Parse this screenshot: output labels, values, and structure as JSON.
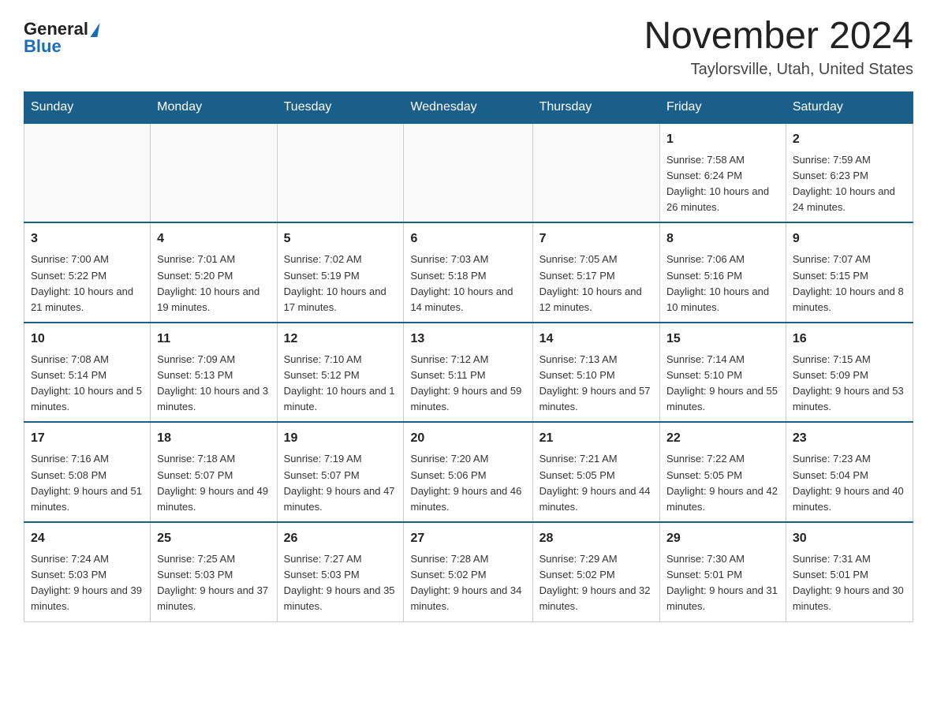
{
  "logo": {
    "general": "General",
    "blue": "Blue"
  },
  "title": "November 2024",
  "location": "Taylorsville, Utah, United States",
  "days_of_week": [
    "Sunday",
    "Monday",
    "Tuesday",
    "Wednesday",
    "Thursday",
    "Friday",
    "Saturday"
  ],
  "weeks": [
    [
      {
        "day": "",
        "info": ""
      },
      {
        "day": "",
        "info": ""
      },
      {
        "day": "",
        "info": ""
      },
      {
        "day": "",
        "info": ""
      },
      {
        "day": "",
        "info": ""
      },
      {
        "day": "1",
        "info": "Sunrise: 7:58 AM\nSunset: 6:24 PM\nDaylight: 10 hours and 26 minutes."
      },
      {
        "day": "2",
        "info": "Sunrise: 7:59 AM\nSunset: 6:23 PM\nDaylight: 10 hours and 24 minutes."
      }
    ],
    [
      {
        "day": "3",
        "info": "Sunrise: 7:00 AM\nSunset: 5:22 PM\nDaylight: 10 hours and 21 minutes."
      },
      {
        "day": "4",
        "info": "Sunrise: 7:01 AM\nSunset: 5:20 PM\nDaylight: 10 hours and 19 minutes."
      },
      {
        "day": "5",
        "info": "Sunrise: 7:02 AM\nSunset: 5:19 PM\nDaylight: 10 hours and 17 minutes."
      },
      {
        "day": "6",
        "info": "Sunrise: 7:03 AM\nSunset: 5:18 PM\nDaylight: 10 hours and 14 minutes."
      },
      {
        "day": "7",
        "info": "Sunrise: 7:05 AM\nSunset: 5:17 PM\nDaylight: 10 hours and 12 minutes."
      },
      {
        "day": "8",
        "info": "Sunrise: 7:06 AM\nSunset: 5:16 PM\nDaylight: 10 hours and 10 minutes."
      },
      {
        "day": "9",
        "info": "Sunrise: 7:07 AM\nSunset: 5:15 PM\nDaylight: 10 hours and 8 minutes."
      }
    ],
    [
      {
        "day": "10",
        "info": "Sunrise: 7:08 AM\nSunset: 5:14 PM\nDaylight: 10 hours and 5 minutes."
      },
      {
        "day": "11",
        "info": "Sunrise: 7:09 AM\nSunset: 5:13 PM\nDaylight: 10 hours and 3 minutes."
      },
      {
        "day": "12",
        "info": "Sunrise: 7:10 AM\nSunset: 5:12 PM\nDaylight: 10 hours and 1 minute."
      },
      {
        "day": "13",
        "info": "Sunrise: 7:12 AM\nSunset: 5:11 PM\nDaylight: 9 hours and 59 minutes."
      },
      {
        "day": "14",
        "info": "Sunrise: 7:13 AM\nSunset: 5:10 PM\nDaylight: 9 hours and 57 minutes."
      },
      {
        "day": "15",
        "info": "Sunrise: 7:14 AM\nSunset: 5:10 PM\nDaylight: 9 hours and 55 minutes."
      },
      {
        "day": "16",
        "info": "Sunrise: 7:15 AM\nSunset: 5:09 PM\nDaylight: 9 hours and 53 minutes."
      }
    ],
    [
      {
        "day": "17",
        "info": "Sunrise: 7:16 AM\nSunset: 5:08 PM\nDaylight: 9 hours and 51 minutes."
      },
      {
        "day": "18",
        "info": "Sunrise: 7:18 AM\nSunset: 5:07 PM\nDaylight: 9 hours and 49 minutes."
      },
      {
        "day": "19",
        "info": "Sunrise: 7:19 AM\nSunset: 5:07 PM\nDaylight: 9 hours and 47 minutes."
      },
      {
        "day": "20",
        "info": "Sunrise: 7:20 AM\nSunset: 5:06 PM\nDaylight: 9 hours and 46 minutes."
      },
      {
        "day": "21",
        "info": "Sunrise: 7:21 AM\nSunset: 5:05 PM\nDaylight: 9 hours and 44 minutes."
      },
      {
        "day": "22",
        "info": "Sunrise: 7:22 AM\nSunset: 5:05 PM\nDaylight: 9 hours and 42 minutes."
      },
      {
        "day": "23",
        "info": "Sunrise: 7:23 AM\nSunset: 5:04 PM\nDaylight: 9 hours and 40 minutes."
      }
    ],
    [
      {
        "day": "24",
        "info": "Sunrise: 7:24 AM\nSunset: 5:03 PM\nDaylight: 9 hours and 39 minutes."
      },
      {
        "day": "25",
        "info": "Sunrise: 7:25 AM\nSunset: 5:03 PM\nDaylight: 9 hours and 37 minutes."
      },
      {
        "day": "26",
        "info": "Sunrise: 7:27 AM\nSunset: 5:03 PM\nDaylight: 9 hours and 35 minutes."
      },
      {
        "day": "27",
        "info": "Sunrise: 7:28 AM\nSunset: 5:02 PM\nDaylight: 9 hours and 34 minutes."
      },
      {
        "day": "28",
        "info": "Sunrise: 7:29 AM\nSunset: 5:02 PM\nDaylight: 9 hours and 32 minutes."
      },
      {
        "day": "29",
        "info": "Sunrise: 7:30 AM\nSunset: 5:01 PM\nDaylight: 9 hours and 31 minutes."
      },
      {
        "day": "30",
        "info": "Sunrise: 7:31 AM\nSunset: 5:01 PM\nDaylight: 9 hours and 30 minutes."
      }
    ]
  ]
}
